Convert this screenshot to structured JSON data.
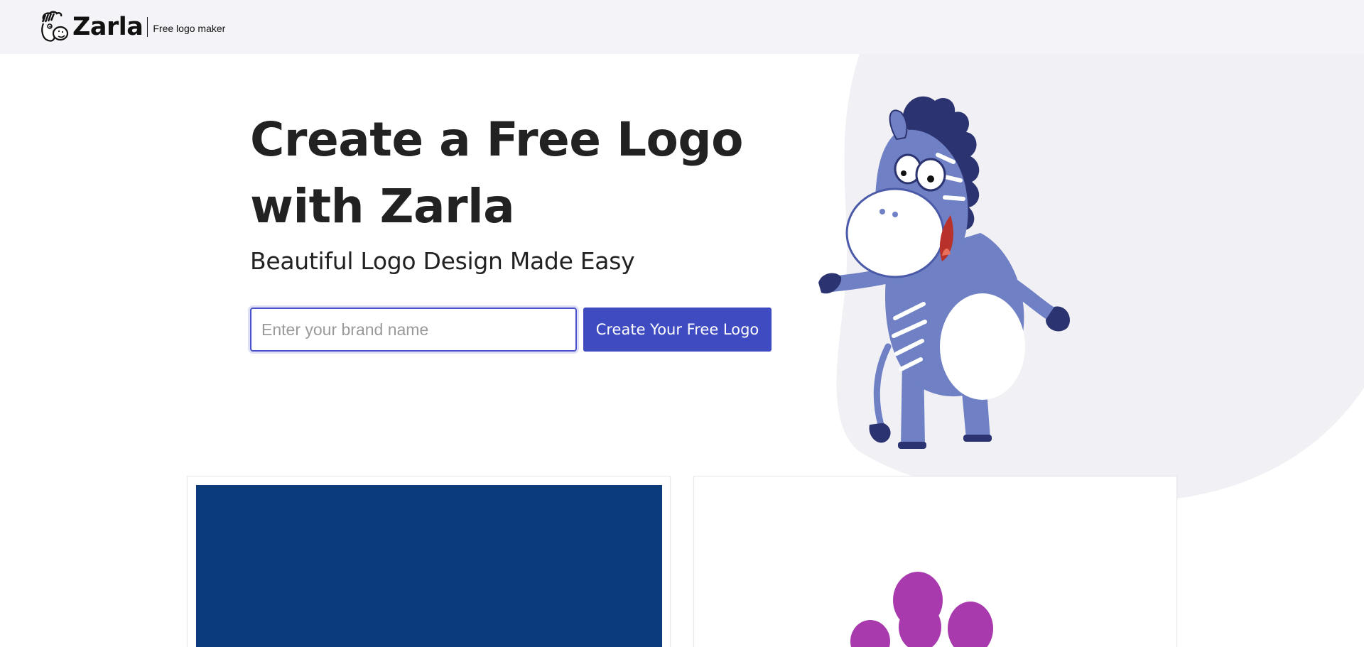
{
  "header": {
    "brand_name": "Zarla",
    "tagline": "Free logo maker",
    "logo_icon": "zebra-head-icon"
  },
  "hero": {
    "title_line1": "Create a Free Logo",
    "title_line2": "with Zarla",
    "subtitle": "Beautiful Logo Design Made Easy",
    "input_placeholder": "Enter your brand name",
    "input_value": "",
    "cta_label": "Create Your Free Logo"
  },
  "mascot": {
    "icon": "zebra-mascot-illustration"
  },
  "colors": {
    "accent": "#3f4bc1",
    "header_bg": "#f4f3f7",
    "blob_bg": "#f1f0f5",
    "zebra_body": "#6f80c4",
    "zebra_dark": "#2b3470",
    "card_left_preview": "#0b3b7a",
    "paw_purple": "#a83aae"
  },
  "logo_previews": [
    {
      "name": "dark-blue-logo-preview"
    },
    {
      "name": "purple-paw-logo-preview"
    }
  ]
}
